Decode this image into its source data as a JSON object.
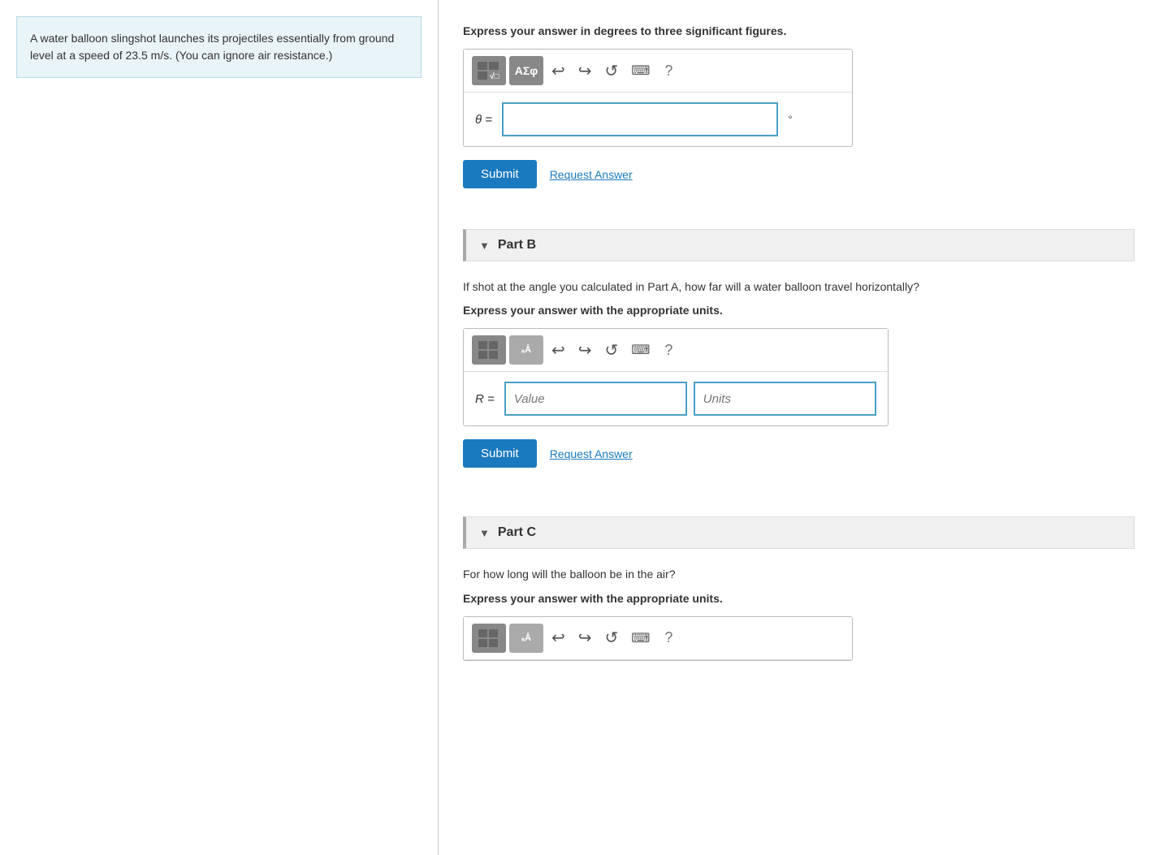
{
  "left": {
    "problem_text": "A water balloon slingshot launches its projectiles essentially from ground level at a speed of 23.5 m/s. (You can ignore air resistance.)"
  },
  "partA": {
    "answer_note": "Express your answer in degrees to three significant figures.",
    "toolbar": {
      "btn1_label": "⊞√□",
      "btn2_label": "ΑΣφ",
      "undo_icon": "↩",
      "redo_icon": "↪",
      "refresh_icon": "↺",
      "keyboard_icon": "⌨",
      "help_icon": "?"
    },
    "input_label": "θ =",
    "input_placeholder": "",
    "degree_symbol": "°",
    "submit_label": "Submit",
    "request_label": "Request Answer"
  },
  "partB": {
    "header_label": "Part B",
    "question_text": "If shot at the angle you calculated in Part A, how far will a water balloon travel horizontally?",
    "answer_note": "Express your answer with the appropriate units.",
    "toolbar": {
      "btn1_label": "⊞",
      "btn2_label": "Å",
      "undo_icon": "↩",
      "redo_icon": "↪",
      "refresh_icon": "↺",
      "keyboard_icon": "⌨",
      "help_icon": "?"
    },
    "input_label": "R =",
    "value_placeholder": "Value",
    "units_placeholder": "Units",
    "submit_label": "Submit",
    "request_label": "Request Answer"
  },
  "partC": {
    "header_label": "Part C",
    "question_text": "For how long will the balloon be in the air?",
    "answer_note": "Express your answer with the appropriate units.",
    "toolbar": {
      "btn1_label": "⊞",
      "btn2_label": "Å",
      "undo_icon": "↩",
      "redo_icon": "↪",
      "refresh_icon": "↺",
      "keyboard_icon": "⌨",
      "help_icon": "?"
    }
  }
}
